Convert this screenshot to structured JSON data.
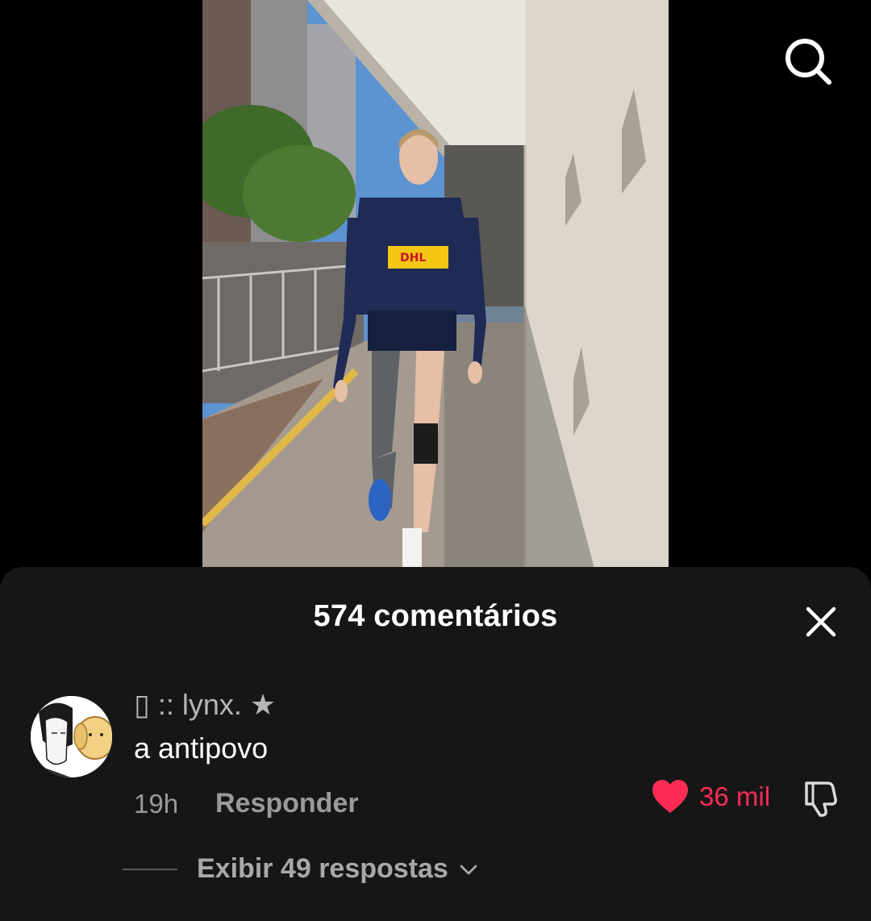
{
  "video": {
    "description_icon": "video-player"
  },
  "toolbar": {
    "search_icon": "search-icon"
  },
  "comments_sheet": {
    "title": "574 comentários",
    "close_icon": "close-icon"
  },
  "comment": {
    "username": "▯ :: lynx. ★",
    "text": "a antipovo",
    "time": "19h",
    "reply_label": "Responder",
    "like_count": "36 mil",
    "liked": true,
    "like_color": "#fe2c55",
    "replies_label": "Exibir 49 respostas"
  },
  "colors": {
    "sheet_background": "#161616",
    "accent": "#fe2c55"
  }
}
